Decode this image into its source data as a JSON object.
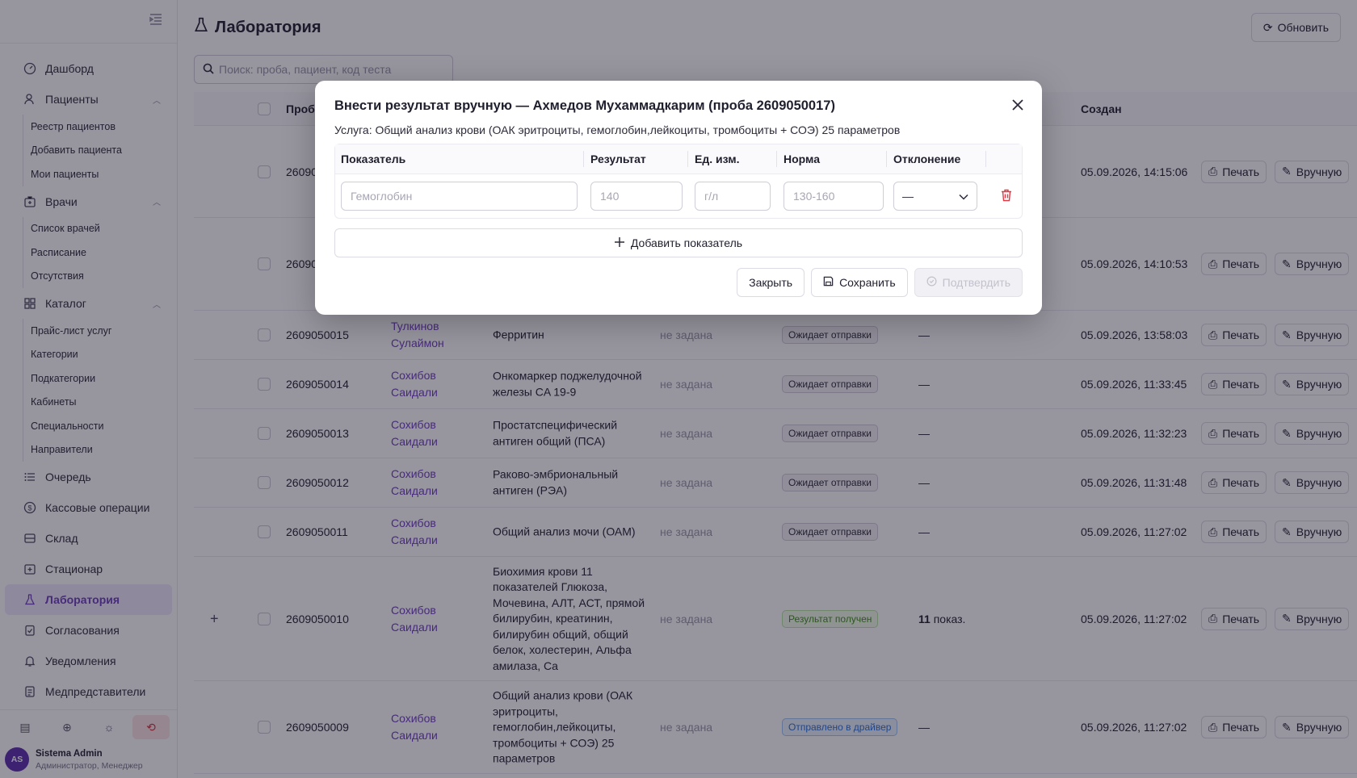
{
  "sidebar": {
    "nav": {
      "dashboard": "Дашборд",
      "patients": "Пациенты",
      "patients_sub": [
        "Реестр пациентов",
        "Добавить пациента",
        "Мои пациенты"
      ],
      "doctors": "Врачи",
      "doctors_sub": [
        "Список врачей",
        "Расписание",
        "Отсутствия"
      ],
      "catalog": "Каталог",
      "catalog_sub": [
        "Прайс-лист услуг",
        "Категории",
        "Подкатегории",
        "Кабинеты",
        "Специальности",
        "Направители"
      ],
      "queue": "Очередь",
      "cash": "Кассовые операции",
      "warehouse": "Склад",
      "hospital": "Стационар",
      "laboratory": "Лаборатория",
      "approvals": "Согласования",
      "notifications": "Уведомления",
      "medreps": "Медпредставители"
    },
    "user": {
      "initials": "AS",
      "name": "Sistema Admin",
      "role": "Администратор, Менеджер"
    }
  },
  "page": {
    "title": "Лаборатория",
    "refresh_label": "Обновить",
    "search_placeholder": "Поиск: проба, пациент, код теста"
  },
  "table": {
    "headers": {
      "sample": "Проба",
      "created": "Создан"
    },
    "print_label": "Печать",
    "manual_label": "Вручную",
    "rows": [
      {
        "id": "26090500",
        "patient": "",
        "service": "",
        "norm": "",
        "status": "",
        "deviation": "",
        "created": "05.09.2026, 14:15:06"
      },
      {
        "id": "26090500",
        "patient": "",
        "service": "",
        "norm": "",
        "status": "",
        "deviation": "",
        "created": "05.09.2026, 14:10:53"
      },
      {
        "id": "2609050015",
        "patient": [
          "Тулкинов",
          "Сулаймон"
        ],
        "service": "Ферритин",
        "norm": "не задана",
        "status": "Ожидает отправки",
        "deviation": "—",
        "created": "05.09.2026, 13:58:03"
      },
      {
        "id": "2609050014",
        "patient": [
          "Сохибов",
          "Саидали"
        ],
        "service": "Онкомаркер поджелудочной железы CA 19-9",
        "norm": "не задана",
        "status": "Ожидает отправки",
        "deviation": "—",
        "created": "05.09.2026, 11:33:45"
      },
      {
        "id": "2609050013",
        "patient": [
          "Сохибов",
          "Саидали"
        ],
        "service": "Простатспецифический антиген общий (ПСА)",
        "norm": "не задана",
        "status": "Ожидает отправки",
        "deviation": "—",
        "created": "05.09.2026, 11:32:23"
      },
      {
        "id": "2609050012",
        "patient": [
          "Сохибов",
          "Саидали"
        ],
        "service": "Раково-эмбриональный антиген (РЭА)",
        "norm": "не задана",
        "status": "Ожидает отправки",
        "deviation": "—",
        "created": "05.09.2026, 11:31:48"
      },
      {
        "id": "2609050011",
        "patient": [
          "Сохибов",
          "Саидали"
        ],
        "service": "Общий анализ мочи (ОАМ)",
        "norm": "не задана",
        "status": "Ожидает отправки",
        "deviation": "—",
        "created": "05.09.2026, 11:27:02"
      },
      {
        "id": "2609050010",
        "patient": [
          "Сохибов",
          "Саидали"
        ],
        "service": "Биохимия крови 11 показателей Глюкоза, Мочевина, АЛТ, АСТ, прямой билирубин, креатинин, билирубин общий, общий белок, холестерин, Альфа амилаза, Ca",
        "norm": "не задана",
        "status": "Результат получен",
        "deviation_count": "11",
        "deviation_suffix": "показ.",
        "created": "05.09.2026, 11:27:02"
      },
      {
        "id": "2609050009",
        "patient": [
          "Сохибов",
          "Саидали"
        ],
        "service": "Общий анализ крови (ОАК эритроциты, гемоглобин,лейкоциты, тромбоциты + СОЭ) 25 параметров",
        "norm": "не задана",
        "status": "Отправлено в драйвер",
        "deviation": "—",
        "created": "05.09.2026, 11:27:02"
      }
    ]
  },
  "modal": {
    "title": "Внести результат вручную — Ахмедов Мухаммадкарим (проба 2609050017)",
    "service_line": "Услуга: Общий анализ крови (ОАК эритроциты, гемоглобин,лейкоциты, тромбоциты + СОЭ) 25 параметров",
    "columns": {
      "indicator": "Показатель",
      "result": "Результат",
      "unit": "Ед. изм.",
      "norm": "Норма",
      "deviation": "Отклонение"
    },
    "row": {
      "indicator_placeholder": "Гемоглобин",
      "result_placeholder": "140",
      "unit_placeholder": "г/л",
      "norm_placeholder": "130-160",
      "deviation_value": "—"
    },
    "add_label": "Добавить показатель",
    "close_label": "Закрыть",
    "save_label": "Сохранить",
    "confirm_label": "Подтвердить"
  },
  "colors": {
    "accent": "#6d3fc0",
    "danger": "#e03a47",
    "overlay": "rgba(24,20,40,0.45)"
  }
}
